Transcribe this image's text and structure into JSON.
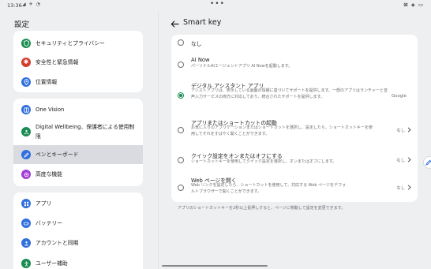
{
  "status": {
    "time": "13:36",
    "left_icons": "◢ ✈ ◔",
    "dots": "•••",
    "right": "⊠ ◈ ▭"
  },
  "sidebar": {
    "title": "設定",
    "groups": [
      {
        "items": [
          {
            "label": "セキュリティとプライバシー",
            "icon": "shield-icon",
            "color": "#1a8d52"
          },
          {
            "label": "安全性と緊急情報",
            "icon": "emergency-icon",
            "color": "#d33d2f"
          },
          {
            "label": "位置情報",
            "icon": "location-icon",
            "color": "#2f6fde"
          }
        ]
      },
      {
        "items": [
          {
            "label": "One Vision",
            "icon": "one-vision-icon",
            "color": "#2f6fde"
          },
          {
            "label": "Digital Wellbeing、保護者による使用制限",
            "icon": "wellbeing-icon",
            "color": "#1a8d52"
          },
          {
            "label": "ペンとキーボード",
            "icon": "pen-icon",
            "color": "#2f6fde"
          },
          {
            "label": "高度な機能",
            "icon": "advanced-icon",
            "color": "#a13cd6"
          }
        ]
      },
      {
        "items": [
          {
            "label": "アプリ",
            "icon": "apps-icon",
            "color": "#2f6fde"
          },
          {
            "label": "バッテリー",
            "icon": "battery-icon",
            "color": "#2f6fde"
          },
          {
            "label": "アカウントと同期",
            "icon": "account-icon",
            "color": "#2f6fde"
          },
          {
            "label": "ユーザー補助",
            "icon": "accessibility-icon",
            "color": "#1a8d52"
          }
        ]
      }
    ]
  },
  "main": {
    "title": "Smart key",
    "options": [
      {
        "title": "なし",
        "desc": "",
        "value": "",
        "selected": false
      },
      {
        "title": "AI Now",
        "desc": "パーソナルAIエージェントアプリ AI Nowを起動します。",
        "value": "",
        "selected": false
      },
      {
        "title": "デジタル アシスタント アプリ",
        "desc": "アシストアプリは、表示している画面の情報に基づいてサポートを提供します。一部のアプリはランチャーと音声入力サービスの両方に対応しており、統合されたサポートを提供します。",
        "value": "Google",
        "selected": true
      },
      {
        "title": "アプリまたはショートカットの起動",
        "desc": "お気に入りのアプリケーションまたはショートカットを選択し、設定したら、ショートカットキーを使用してそれをすばやく開くことができます。",
        "value": "なし",
        "selected": false
      },
      {
        "title": "クイック設定をオンまたはオフにする",
        "desc": "ショートカットキーを使用してクイック設定を選択し、オンまたはオフにします。",
        "value": "なし",
        "selected": false
      },
      {
        "title": "Web ページを開く",
        "desc": "Web リンクを設定したら、ショートカットを使用して、対応する Web ページをデフォルトブラウザーで開くことができます。",
        "value": "なし",
        "selected": false
      }
    ],
    "footnote": "アプリのショートカットキーを2秒以上長押しすると、ページに移動して設定を変更できます。"
  },
  "colors": {
    "accent": "#1a8d52",
    "selected_bg": "#d9dbe0"
  }
}
